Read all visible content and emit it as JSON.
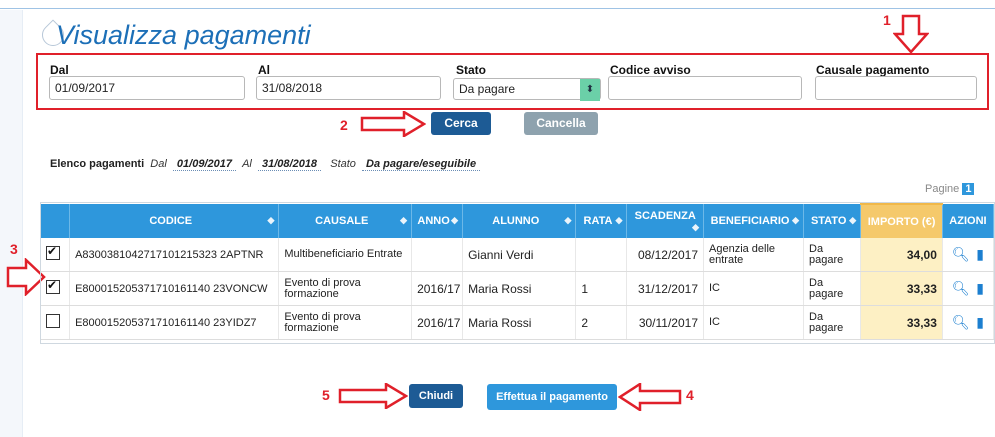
{
  "page": {
    "title": "Visualizza pagamenti"
  },
  "filters": {
    "dal_label": "Dal",
    "dal_value": "01/09/2017",
    "al_label": "Al",
    "al_value": "31/08/2018",
    "stato_label": "Stato",
    "stato_value": "Da pagare",
    "codice_label": "Codice avviso",
    "codice_value": "",
    "causale_label": "Causale pagamento",
    "causale_value": ""
  },
  "buttons": {
    "cerca": "Cerca",
    "cancella": "Cancella",
    "chiudi": "Chiudi",
    "effettua": "Effettua il pagamento"
  },
  "annotations": {
    "n1": "1",
    "n2": "2",
    "n3": "3",
    "n4": "4",
    "n5": "5"
  },
  "summary": {
    "title": "Elenco pagamenti",
    "dal_label": "Dal",
    "dal_value": "01/09/2017",
    "al_label": "Al",
    "al_value": "31/08/2018",
    "stato_label": "Stato",
    "stato_value": "Da pagare/eseguibile"
  },
  "pager": {
    "label": "Pagine",
    "current": "1"
  },
  "table": {
    "headers": {
      "codice": "CODICE",
      "causale": "CAUSALE",
      "anno": "ANNO",
      "alunno": "ALUNNO",
      "rata": "RATA",
      "scadenza": "SCADENZA",
      "beneficiario": "BENEFICIARIO",
      "stato": "STATO",
      "importo": "IMPORTO (€)",
      "azioni": "AZIONI"
    },
    "rows": [
      {
        "checked": true,
        "codice": "A8300381042717101215323 2APTNR",
        "causale": "Multibeneficiario Entrate",
        "anno": "",
        "alunno": "Gianni Verdi",
        "rata": "",
        "scadenza": "08/12/2017",
        "beneficiario": "Agenzia delle entrate",
        "stato": "Da pagare",
        "importo": "34,00"
      },
      {
        "checked": true,
        "codice": "E800015205371710161140 23VONCW",
        "causale": "Evento di prova formazione",
        "anno": "2016/17",
        "alunno": "Maria Rossi",
        "rata": "1",
        "scadenza": "31/12/2017",
        "beneficiario": "IC",
        "stato": "Da pagare",
        "importo": "33,33"
      },
      {
        "checked": false,
        "codice": "E800015205371710161140 23YIDZ7",
        "causale": "Evento di prova formazione",
        "anno": "2016/17",
        "alunno": "Maria Rossi",
        "rata": "2",
        "scadenza": "30/11/2017",
        "beneficiario": "IC",
        "stato": "Da pagare",
        "importo": "33,33"
      }
    ]
  },
  "colors": {
    "accent": "#2e97dc",
    "annotation": "#e0202a",
    "importo_bg": "#fdf0c4"
  },
  "icons": {
    "search": "search-icon",
    "document": "document-icon"
  }
}
